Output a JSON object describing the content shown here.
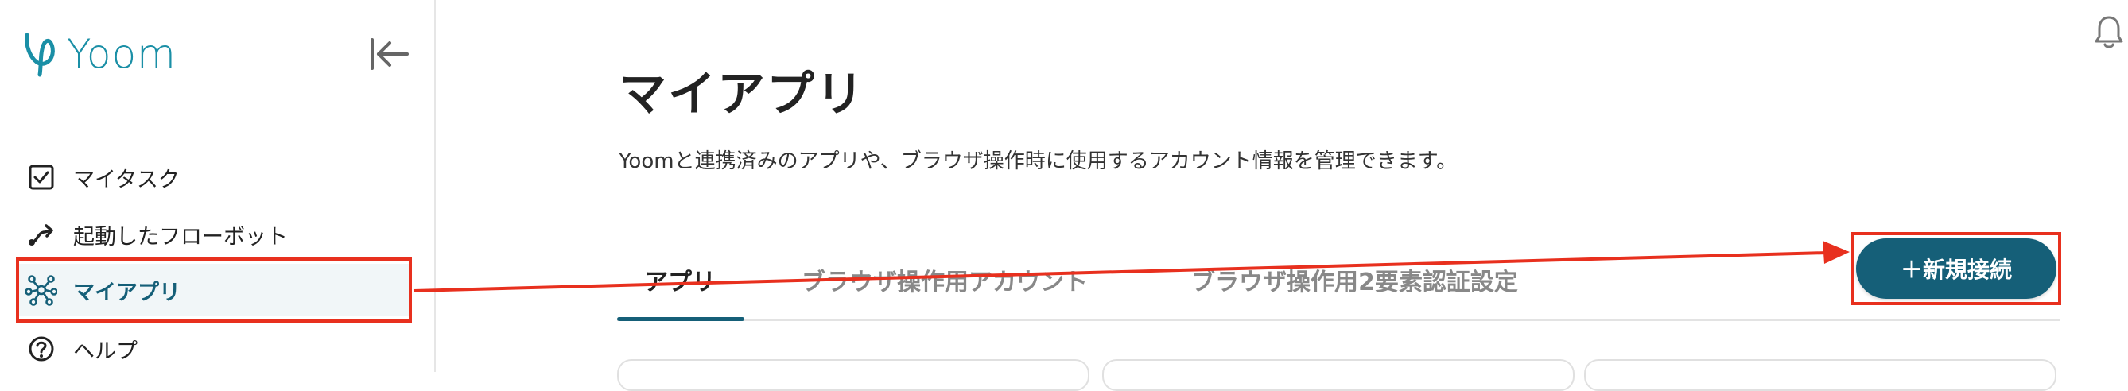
{
  "app": {
    "logo_text": "Yoom",
    "brand_color": "#1a8fa6",
    "accent_color": "#155f78"
  },
  "sidebar": {
    "collapse_icon": "collapse-left-icon",
    "items": [
      {
        "label": "マイタスク",
        "icon": "checkbox-icon",
        "active": false
      },
      {
        "label": "起動したフローボット",
        "icon": "flow-icon",
        "active": false
      },
      {
        "label": "マイアプリ",
        "icon": "network-icon",
        "active": true
      },
      {
        "label": "ヘルプ",
        "icon": "help-icon",
        "active": false
      }
    ]
  },
  "main": {
    "title": "マイアプリ",
    "subtitle": "Yoomと連携済みのアプリや、ブラウザ操作時に使用するアカウント情報を管理できます。",
    "tabs": [
      {
        "label": "アプリ",
        "active": true
      },
      {
        "label": "ブラウザ操作用アカウント",
        "active": false
      },
      {
        "label": "ブラウザ操作用2要素認証設定",
        "active": false
      }
    ],
    "new_button_label": "＋新規接続"
  },
  "header": {
    "notification_icon": "bell-icon"
  },
  "annotation": {
    "color": "#e8301e"
  }
}
